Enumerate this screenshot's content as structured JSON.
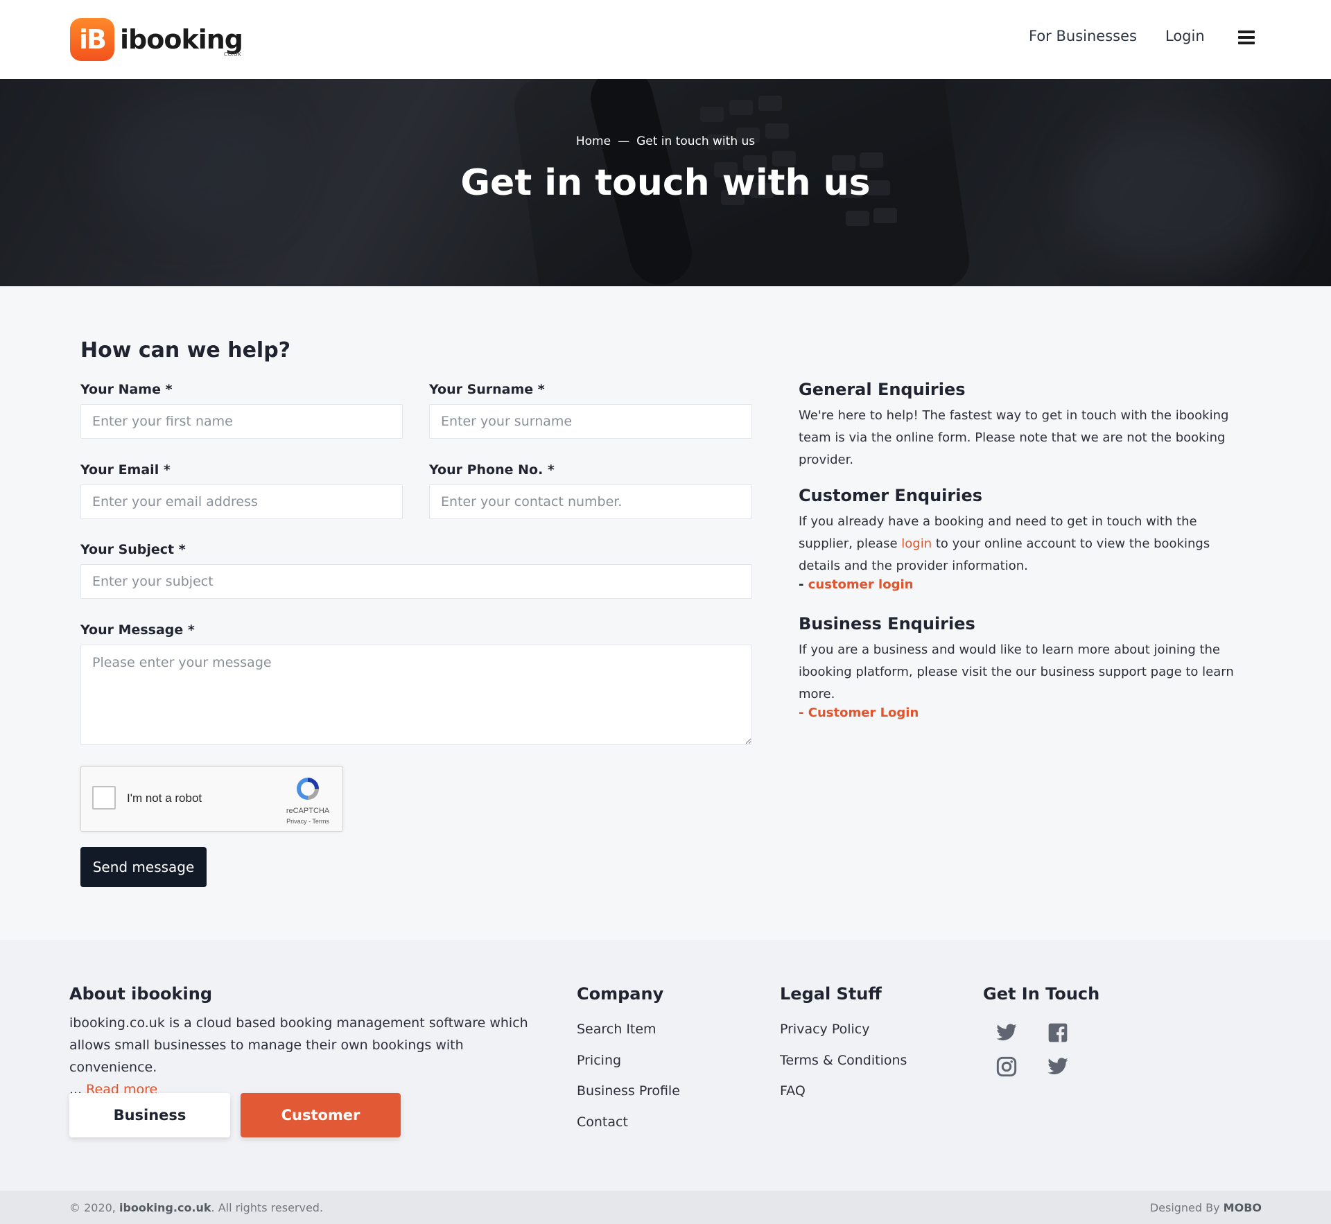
{
  "header": {
    "logo_badge": "iB",
    "logo_text": "ibooking",
    "logo_sub": "CO.UK",
    "nav_business": "For Businesses",
    "nav_login": "Login",
    "menu_icon": "hamburger-icon"
  },
  "hero": {
    "breadcrumb_home": "Home",
    "breadcrumb_sep": "—",
    "breadcrumb_current": "Get in touch with us",
    "title": "Get in touch with us"
  },
  "form": {
    "title": "How can we help?",
    "name_label": "Your Name *",
    "name_placeholder": "Enter your first name",
    "surname_label": "Your Surname *",
    "surname_placeholder": "Enter your surname",
    "email_label": "Your Email *",
    "email_placeholder": "Enter your email address",
    "phone_label": "Your Phone No. *",
    "phone_placeholder": "Enter your contact number.",
    "subject_label": "Your Subject *",
    "subject_placeholder": "Enter your subject",
    "message_label": "Your Message *",
    "message_placeholder": "Please enter your message",
    "captcha_text": "I'm not a robot",
    "captcha_brand": "reCAPTCHA",
    "captcha_links": "Privacy - Terms",
    "send_label": "Send message"
  },
  "info": {
    "general_title": "General Enquiries",
    "general_text": "We're here to help! The fastest way to get in touch with the ibooking team is via the online form. Please note that we are not the booking provider.",
    "customer_title": "Customer Enquiries",
    "customer_text_before": "If you already have a booking and need to get in touch with the supplier, please ",
    "customer_text_link": "login",
    "customer_text_after": " to your online account to view the bookings details and the provider information.",
    "customer_link_dash": "- ",
    "customer_link": "customer login",
    "business_title": "Business Enquiries",
    "business_text": "If you are a business and would like to learn more about joining the ibooking platform, please visit the our business support page to learn more.",
    "business_link_dash": "- ",
    "business_link": "Customer Login"
  },
  "footer": {
    "about_title": "About ibooking",
    "about_text": "ibooking.co.uk is a cloud based booking management software which allows small businesses to manage their own bookings with convenience.",
    "about_ellipsis": "... ",
    "read_more": "Read more",
    "business_btn": "Business",
    "customer_btn": "Customer",
    "company_title": "Company",
    "company_links": [
      "Search Item",
      "Pricing",
      "Business Profile",
      "Contact"
    ],
    "legal_title": "Legal Stuff",
    "legal_links": [
      "Privacy Policy",
      "Terms & Conditions",
      "FAQ"
    ],
    "touch_title": "Get In Touch",
    "social_icons": [
      "twitter-icon",
      "facebook-icon",
      "instagram-icon",
      "twitter-icon"
    ],
    "copyright_prefix": "© 2020, ",
    "copyright_site": "ibooking.co.uk",
    "copyright_suffix": ". All rights reserved.",
    "designed_prefix": "Designed By ",
    "designed_by": "MOBO"
  },
  "colors": {
    "accent": "#e15a35",
    "dark_button": "#121a28",
    "page_bg": "#f6f7f9"
  }
}
